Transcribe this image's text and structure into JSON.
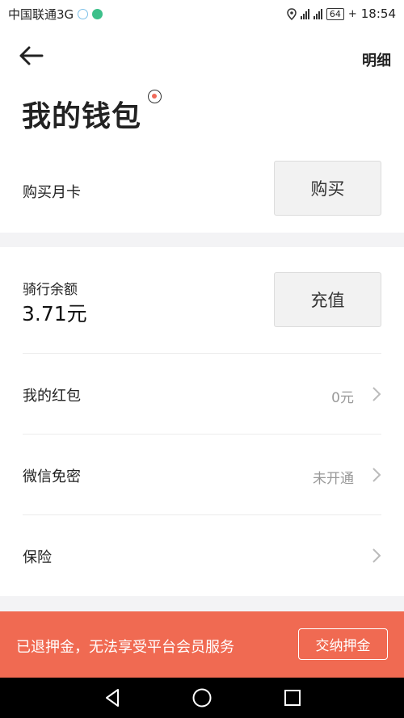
{
  "status_bar": {
    "carrier": "中国联通3G",
    "battery": "64",
    "time": "18:54"
  },
  "nav": {
    "detail_label": "明细"
  },
  "title": "我的钱包",
  "monthly_card": {
    "label": "购买月卡",
    "button_label": "购买"
  },
  "balance": {
    "label": "骑行余额",
    "value": "3.71元",
    "button_label": "充值"
  },
  "list": [
    {
      "label": "我的红包",
      "value": "0元"
    },
    {
      "label": "微信免密",
      "value": "未开通"
    },
    {
      "label": "保险",
      "value": ""
    }
  ],
  "banner": {
    "text": "已退押金，无法享受平台会员服务",
    "button_label": "交纳押金",
    "color": "#f06a52"
  },
  "icons": {
    "back": "arrow-left-icon",
    "chevron": "chevron-right-icon",
    "nav_back": "triangle-back-icon",
    "nav_home": "circle-home-icon",
    "nav_recent": "square-recent-icon"
  }
}
